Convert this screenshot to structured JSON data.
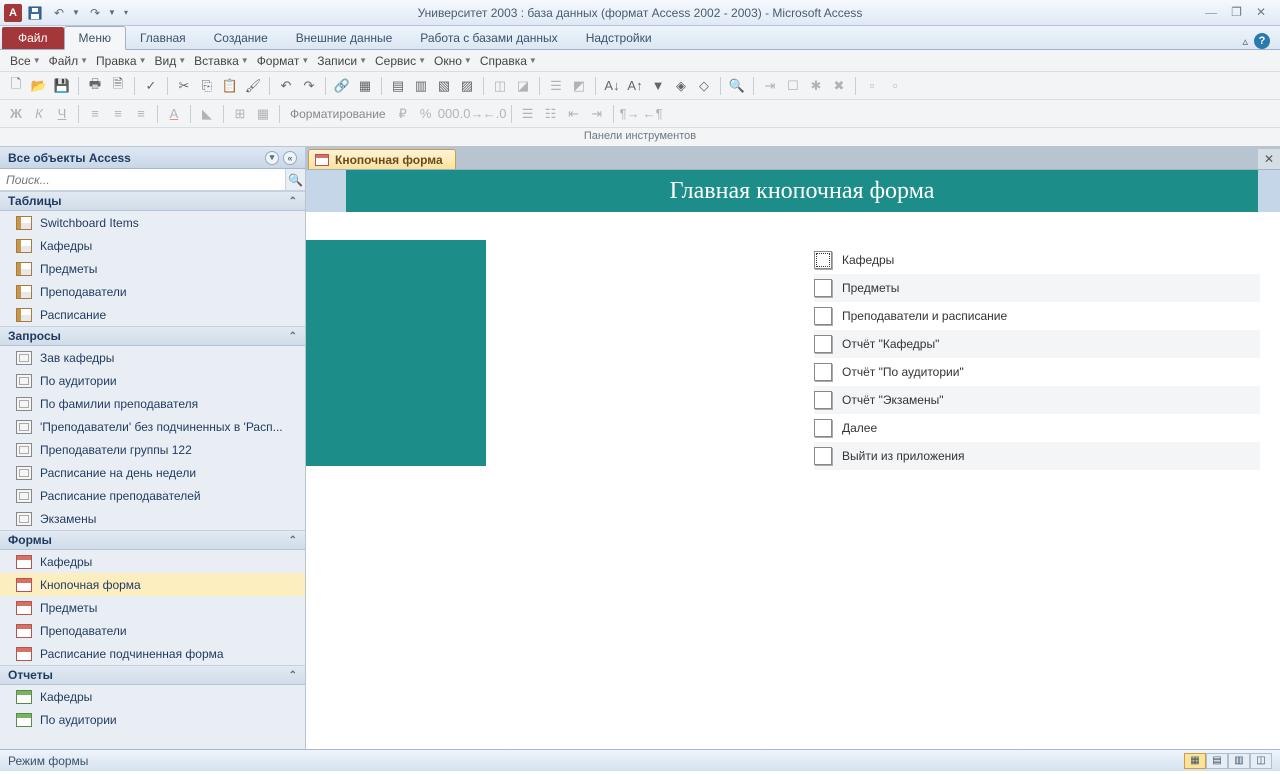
{
  "titlebar": {
    "title": "Университет 2003 : база данных (формат Access 2002 - 2003)  -  Microsoft Access"
  },
  "ribbon": {
    "file": "Файл",
    "tabs": [
      "Меню",
      "Главная",
      "Создание",
      "Внешние данные",
      "Работа с базами данных",
      "Надстройки"
    ],
    "active_tab": 0,
    "menus": [
      "Все",
      "Файл",
      "Правка",
      "Вид",
      "Вставка",
      "Формат",
      "Записи",
      "Сервис",
      "Окно",
      "Справка"
    ],
    "format_label": "Форматирование",
    "panel_label": "Панели инструментов"
  },
  "nav": {
    "header": "Все объекты Access",
    "search_placeholder": "Поиск...",
    "groups": [
      {
        "title": "Таблицы",
        "icon": "table",
        "items": [
          "Switchboard Items",
          "Кафедры",
          "Предметы",
          "Преподаватели",
          "Расписание"
        ]
      },
      {
        "title": "Запросы",
        "icon": "query",
        "items": [
          "Зав кафедры",
          "По аудитории",
          "По фамилии преподавателя",
          "'Преподаватели' без подчиненных в 'Расп...",
          "Преподаватели группы 122",
          "Расписание на день недели",
          "Расписание преподавателей",
          "Экзамены"
        ]
      },
      {
        "title": "Формы",
        "icon": "form",
        "items": [
          "Кафедры",
          "Кнопочная форма",
          "Предметы",
          "Преподаватели",
          "Расписание подчиненная форма"
        ],
        "selected": 1
      },
      {
        "title": "Отчеты",
        "icon": "report",
        "items": [
          "Кафедры",
          "По аудитории"
        ]
      }
    ]
  },
  "doc": {
    "tab_label": "Кнопочная форма",
    "form_title": "Главная кнопочная форма",
    "switchboard": [
      "Кафедры",
      "Предметы",
      "Преподаватели и расписание",
      "Отчёт \"Кафедры\"",
      "Отчёт \"По аудитории\"",
      "Отчёт \"Экзамены\"",
      "Далее",
      "Выйти из приложения"
    ]
  },
  "status": {
    "mode": "Режим формы"
  }
}
